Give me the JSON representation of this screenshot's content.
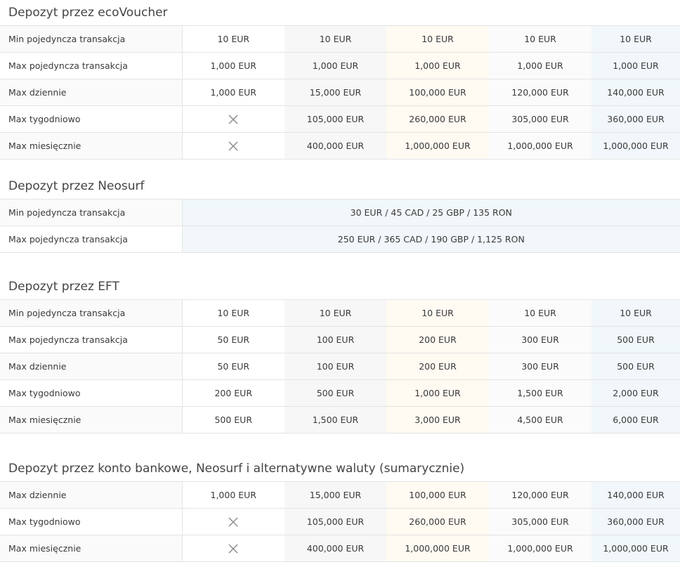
{
  "sections": [
    {
      "title": "Depozyt przez ecoVoucher",
      "rows": [
        {
          "label": "Min pojedyncza transakcja",
          "values": [
            "10 EUR",
            "10 EUR",
            "10 EUR",
            "10 EUR",
            "10 EUR"
          ]
        },
        {
          "label": "Max pojedyncza transakcja",
          "values": [
            "1,000 EUR",
            "1,000 EUR",
            "1,000 EUR",
            "1,000 EUR",
            "1,000 EUR"
          ]
        },
        {
          "label": "Max dziennie",
          "values": [
            "1,000 EUR",
            "15,000 EUR",
            "100,000 EUR",
            "120,000 EUR",
            "140,000 EUR"
          ]
        },
        {
          "label": "Max tygodniowo",
          "values": [
            null,
            "105,000 EUR",
            "260,000 EUR",
            "305,000 EUR",
            "360,000 EUR"
          ]
        },
        {
          "label": "Max miesięcznie",
          "values": [
            null,
            "400,000 EUR",
            "1,000,000 EUR",
            "1,000,000 EUR",
            "1,000,000 EUR"
          ]
        }
      ]
    },
    {
      "title": "Depozyt przez Neosurf",
      "rows": [
        {
          "label": "Min pojedyncza transakcja",
          "value": "30 EUR / 45 CAD / 25 GBP / 135 RON"
        },
        {
          "label": "Max pojedyncza transakcja",
          "value": "250 EUR / 365 CAD / 190 GBP / 1,125 RON"
        }
      ]
    },
    {
      "title": "Depozyt przez EFT",
      "rows": [
        {
          "label": "Min pojedyncza transakcja",
          "values": [
            "10 EUR",
            "10 EUR",
            "10 EUR",
            "10 EUR",
            "10 EUR"
          ]
        },
        {
          "label": "Max pojedyncza transakcja",
          "values": [
            "50 EUR",
            "100 EUR",
            "200 EUR",
            "300 EUR",
            "500 EUR"
          ]
        },
        {
          "label": "Max dziennie",
          "values": [
            "50 EUR",
            "100 EUR",
            "200 EUR",
            "300 EUR",
            "500 EUR"
          ]
        },
        {
          "label": "Max tygodniowo",
          "values": [
            "200 EUR",
            "500 EUR",
            "1,000 EUR",
            "1,500 EUR",
            "2,000 EUR"
          ]
        },
        {
          "label": "Max miesięcznie",
          "values": [
            "500 EUR",
            "1,500 EUR",
            "3,000 EUR",
            "4,500 EUR",
            "6,000 EUR"
          ]
        }
      ]
    },
    {
      "title": "Depozyt przez konto bankowe, Neosurf i alternatywne waluty (sumarycznie)",
      "rows": [
        {
          "label": "Max dziennie",
          "values": [
            "1,000 EUR",
            "15,000 EUR",
            "100,000 EUR",
            "120,000 EUR",
            "140,000 EUR"
          ]
        },
        {
          "label": "Max tygodniowo",
          "values": [
            null,
            "105,000 EUR",
            "260,000 EUR",
            "305,000 EUR",
            "360,000 EUR"
          ]
        },
        {
          "label": "Max miesięcznie",
          "values": [
            null,
            "400,000 EUR",
            "1,000,000 EUR",
            "1,000,000 EUR",
            "1,000,000 EUR"
          ]
        }
      ]
    }
  ],
  "icons": {
    "not_available": "close-x-icon"
  },
  "colors": {
    "text": "#3a3a3a",
    "border": "#e4e4e4",
    "tier2_bg": "#f7f7f7",
    "tier3_bg": "#fffaf2",
    "tier5_bg": "#f1f7fa",
    "x_icon": "#8a8a8a"
  }
}
